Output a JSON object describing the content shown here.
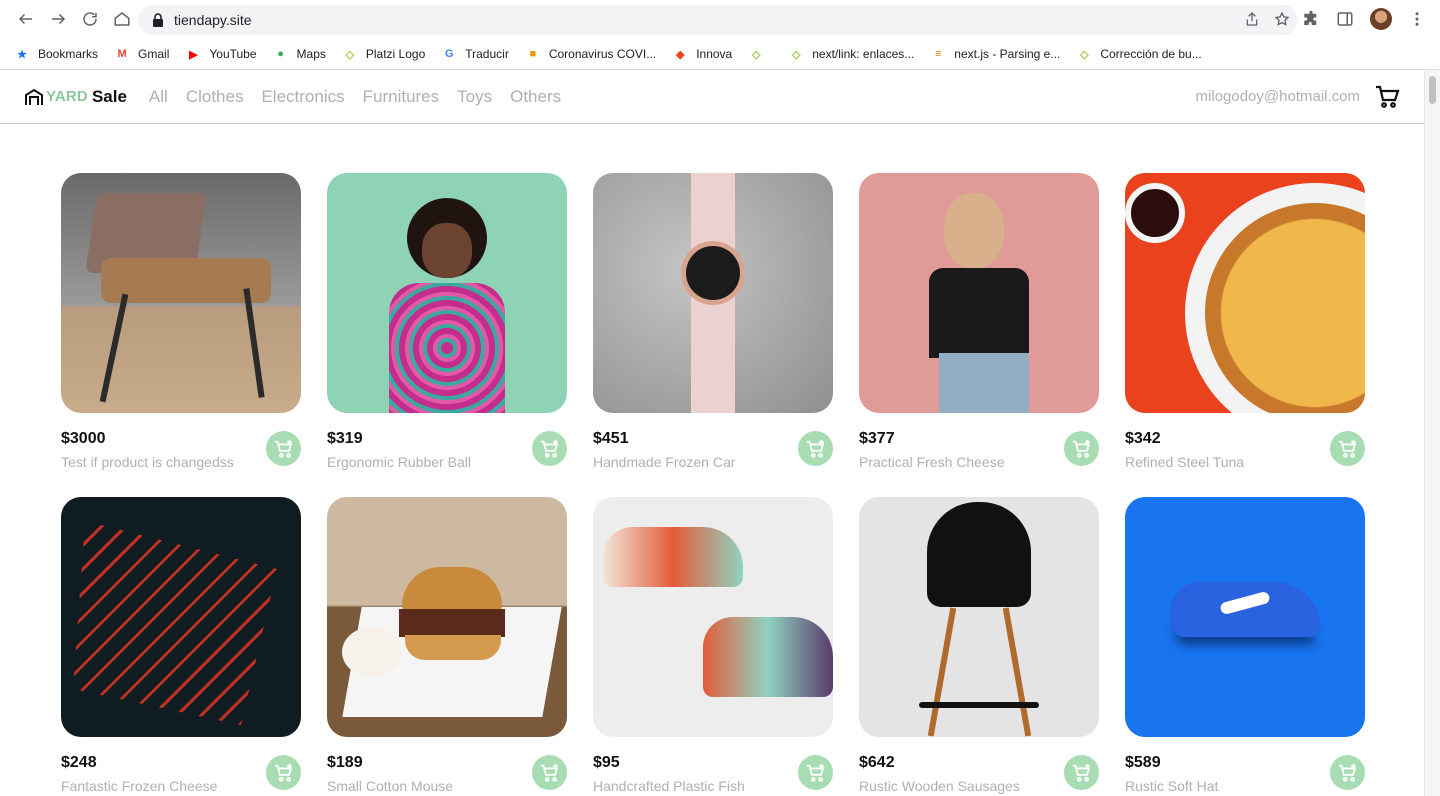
{
  "browser": {
    "url": "tiendapy.site",
    "bookmarks": [
      {
        "label": "Bookmarks",
        "icon": "star-icon",
        "color": "#1a73e8"
      },
      {
        "label": "Gmail",
        "icon": "gmail-icon",
        "color": "#ea4335"
      },
      {
        "label": "YouTube",
        "icon": "youtube-icon",
        "color": "#ff0000"
      },
      {
        "label": "Maps",
        "icon": "maps-icon",
        "color": "#34a853"
      },
      {
        "label": "Platzi Logo",
        "icon": "platzi-icon",
        "color": "#98ca3f"
      },
      {
        "label": "Traducir",
        "icon": "translate-icon",
        "color": "#4285f4"
      },
      {
        "label": "Coronavirus COVI...",
        "icon": "covid-icon",
        "color": "#f29900"
      },
      {
        "label": "Innova",
        "icon": "innova-icon",
        "color": "#e8491d"
      },
      {
        "label": "",
        "icon": "platzi-icon",
        "color": "#98ca3f"
      },
      {
        "label": "next/link: enlaces...",
        "icon": "platzi-icon",
        "color": "#98ca3f"
      },
      {
        "label": "next.js - Parsing e...",
        "icon": "stackoverflow-icon",
        "color": "#f48024"
      },
      {
        "label": "Corrección de bu...",
        "icon": "platzi-icon",
        "color": "#98ca3f"
      }
    ]
  },
  "header": {
    "logo_yard": "YARD",
    "logo_sale": "Sale",
    "nav": [
      "All",
      "Clothes",
      "Electronics",
      "Furnitures",
      "Toys",
      "Others"
    ],
    "email": "milogodoy@hotmail.com"
  },
  "colors": {
    "accent": "#8bc79a",
    "add_button": "#a8dcb2",
    "muted_text": "#b0b0b0"
  },
  "products": [
    {
      "price": "$3000",
      "name": "Test if product is changedss",
      "image": "chair-photo"
    },
    {
      "price": "$319",
      "name": "Ergonomic Rubber Ball",
      "image": "woman-dress-photo"
    },
    {
      "price": "$451",
      "name": "Handmade Frozen Car",
      "image": "watch-photo"
    },
    {
      "price": "$377",
      "name": "Practical Fresh Cheese",
      "image": "woman-tshirt-photo"
    },
    {
      "price": "$342",
      "name": "Refined Steel Tuna",
      "image": "pizza-photo"
    },
    {
      "price": "$248",
      "name": "Fantastic Frozen Cheese",
      "image": "red-chair-photo"
    },
    {
      "price": "$189",
      "name": "Small Cotton Mouse",
      "image": "burger-photo"
    },
    {
      "price": "$95",
      "name": "Handcrafted Plastic Fish",
      "image": "sneakers-photo"
    },
    {
      "price": "$642",
      "name": "Rustic Wooden Sausages",
      "image": "stool-photo"
    },
    {
      "price": "$589",
      "name": "Rustic Soft Hat",
      "image": "blue-shoe-photo"
    }
  ]
}
